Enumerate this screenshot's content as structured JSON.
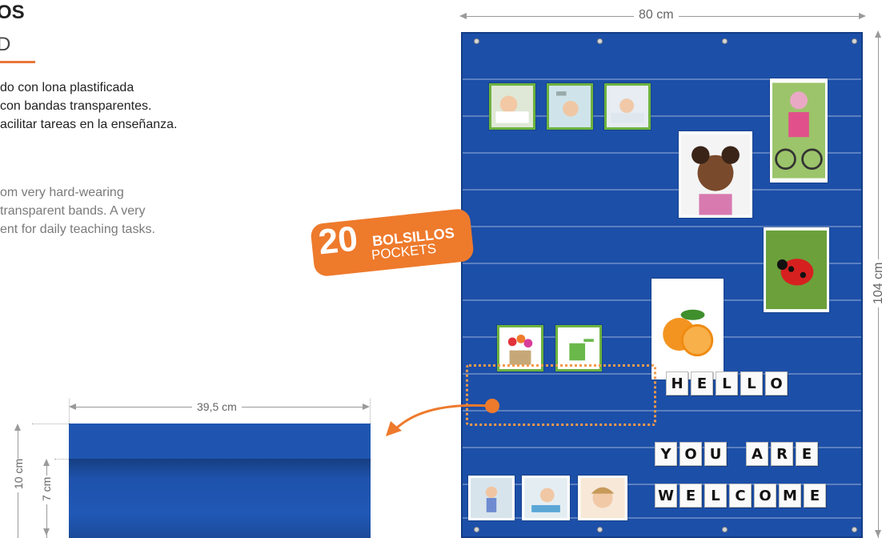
{
  "heading": {
    "title": "OS",
    "subtitle": "D",
    "desc_es": "do con lona plastificada\ncon bandas transparentes.\nacilitar tareas en la enseñanza.",
    "desc_en": "om very hard-wearing\ntransparent bands. A very\nent for daily teaching tasks."
  },
  "dimensions": {
    "width": "80 cm",
    "height": "104 cm",
    "pocket_width": "39,5 cm",
    "pocket_total": "10 cm",
    "pocket_front": "7 cm"
  },
  "badge": {
    "number": "20",
    "line1": "BOLSILLOS",
    "line2": "POCKETS"
  },
  "words": {
    "row1": [
      "H",
      "E",
      "L",
      "L",
      "O"
    ],
    "row2a": [
      "Y",
      "O",
      "U"
    ],
    "row2b": [
      "A",
      "R",
      "E"
    ],
    "row3": [
      "W",
      "E",
      "L",
      "C",
      "O",
      "M",
      "E"
    ]
  },
  "colors": {
    "chart_blue": "#1c4fa8",
    "accent_orange": "#ee7a2c",
    "card_border_green": "#6db33f"
  }
}
